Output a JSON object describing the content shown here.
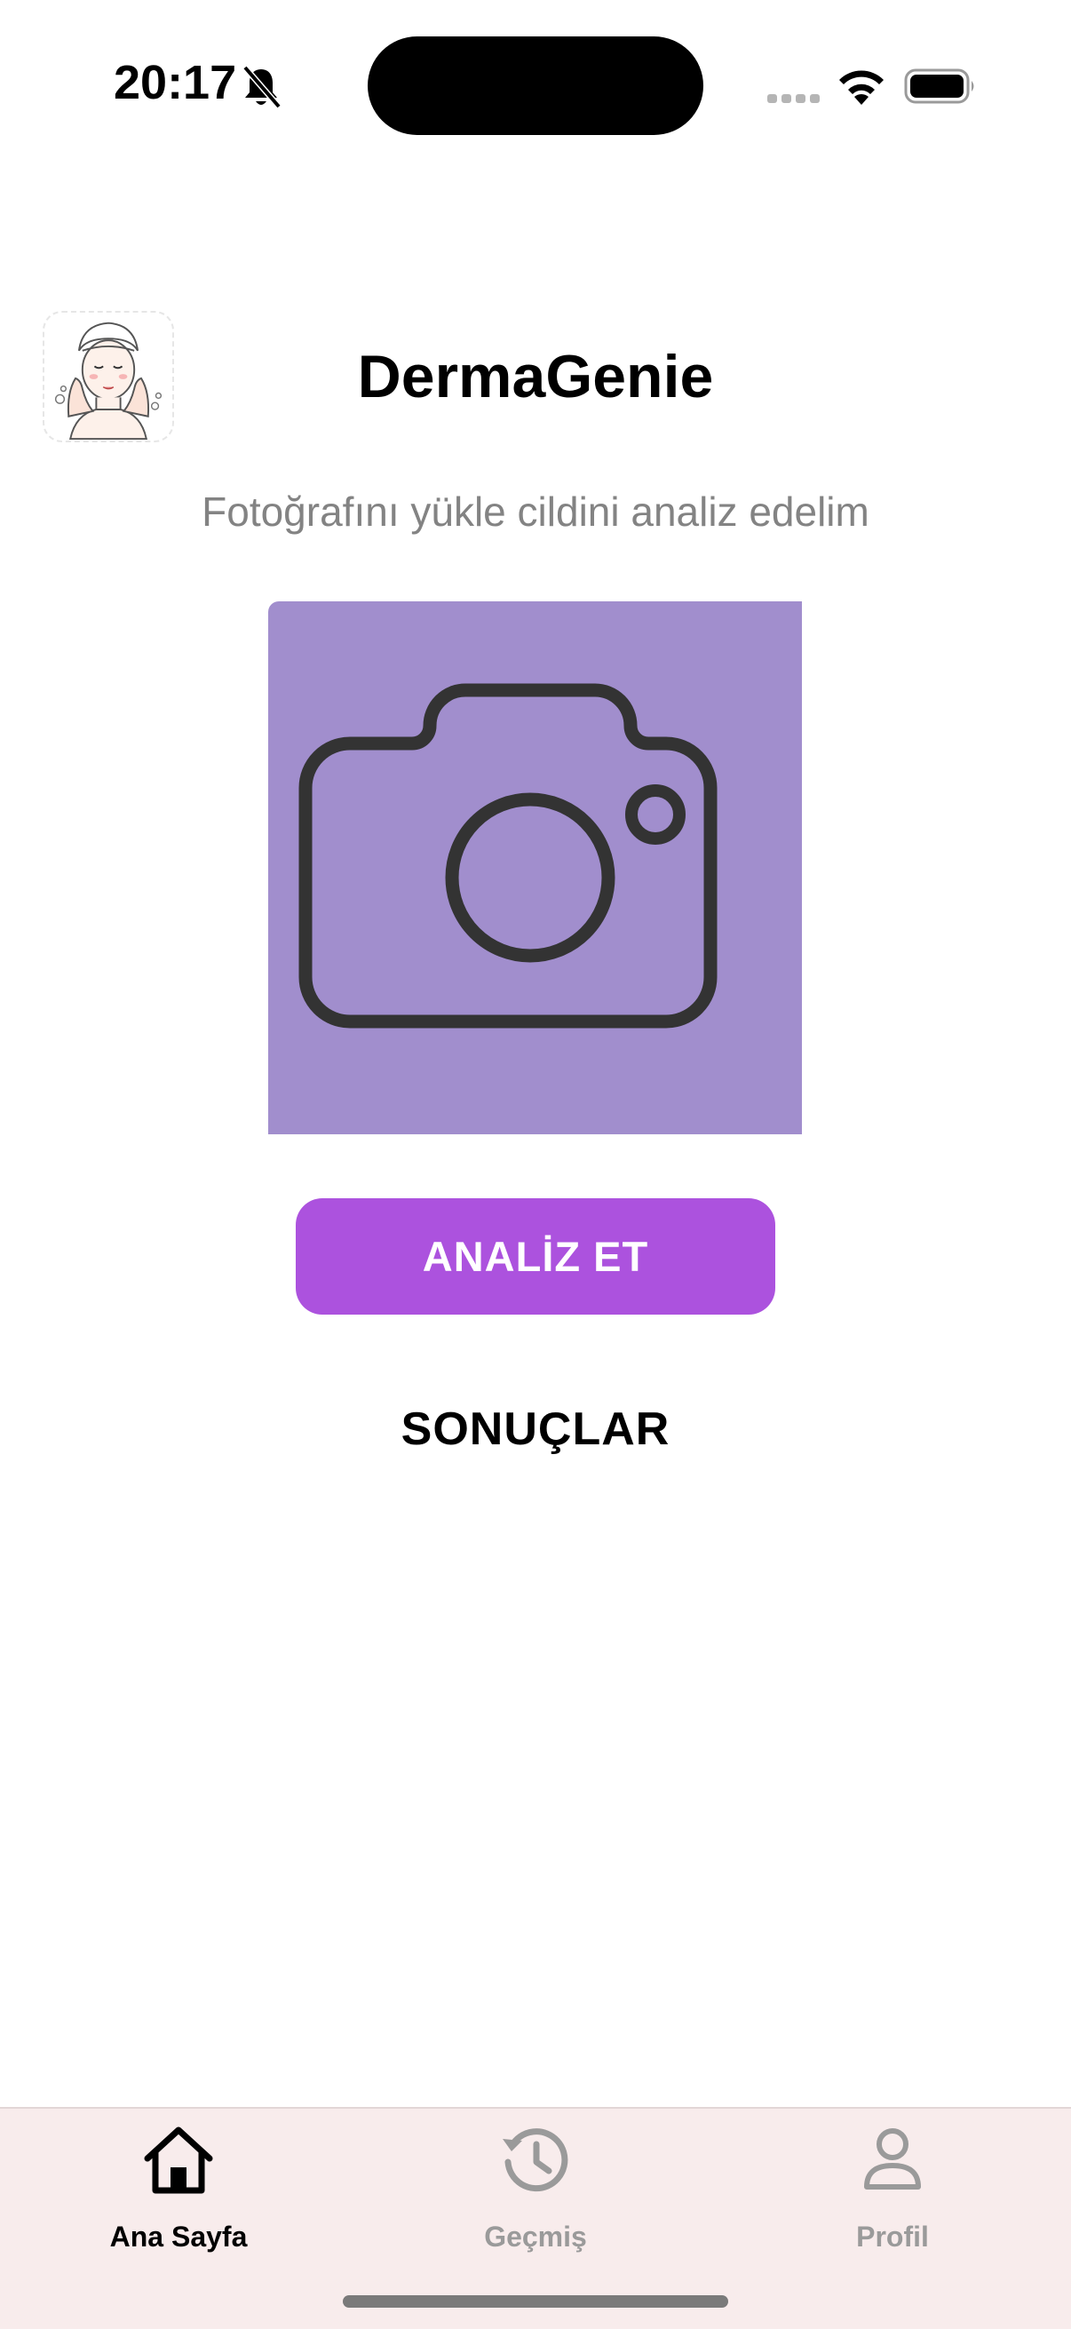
{
  "status_bar": {
    "time": "20:17",
    "icons": [
      "bell-slash-icon",
      "signal-icon",
      "wifi-icon",
      "battery-icon"
    ]
  },
  "header": {
    "title": "DermaGenie",
    "subtitle": "Fotoğrafını yükle cildini analiz edelim",
    "avatar_icon": "skincare-avatar-icon"
  },
  "photo_picker": {
    "icon": "camera-icon",
    "background_color": "#a18ecd"
  },
  "actions": {
    "analyze_label": "ANALİZ ET",
    "results_label": "SONUÇLAR",
    "accent_color": "#ac52de"
  },
  "tab_bar": {
    "background_color": "#f8ecec",
    "tabs": [
      {
        "label": "Ana Sayfa",
        "icon": "home-icon",
        "active": true
      },
      {
        "label": "Geçmiş",
        "icon": "history-icon",
        "active": false
      },
      {
        "label": "Profil",
        "icon": "profile-icon",
        "active": false
      }
    ]
  }
}
